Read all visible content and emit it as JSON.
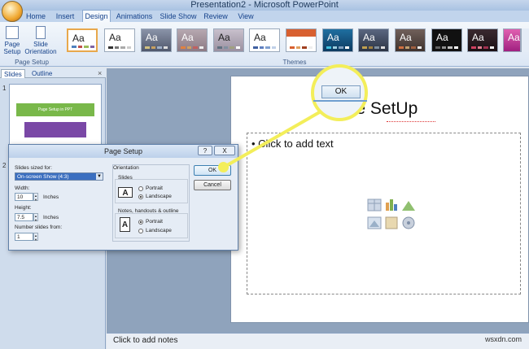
{
  "window": {
    "title": "Presentation2 - Microsoft PowerPoint"
  },
  "tabs": [
    "Home",
    "Insert",
    "Design",
    "Animations",
    "Slide Show",
    "Review",
    "View"
  ],
  "active_tab": "Design",
  "ribbon": {
    "page_setup_label": "Page\nSetup",
    "slide_orientation_label": "Slide\nOrientation",
    "group_page_setup": "Page Setup",
    "group_themes": "Themes",
    "theme_text": "Aa"
  },
  "left_pane": {
    "tabs": [
      "Slides",
      "Outline"
    ],
    "close": "×",
    "slide_numbers": [
      "1",
      "2"
    ],
    "thumb_text": "Page Setup in PPT"
  },
  "slide": {
    "title": "Page SetUp",
    "bullet": "Click to add text",
    "notes": "Click to add notes"
  },
  "dialog": {
    "title": "Page Setup",
    "help": "?",
    "close": "X",
    "slides_sized_for_label": "Slides sized for:",
    "slides_sized_for_value": "On-screen Show (4:3)",
    "width_label": "Width:",
    "width_value": "10",
    "width_unit": "Inches",
    "height_label": "Height:",
    "height_value": "7.5",
    "height_unit": "Inches",
    "number_from_label": "Number slides from:",
    "number_from_value": "1",
    "orientation_label": "Orientation",
    "slides_label": "Slides",
    "portrait": "Portrait",
    "landscape": "Landscape",
    "notes_label": "Notes, handouts & outline",
    "ok": "OK",
    "cancel": "Cancel",
    "slides_orientation_selected": "Landscape",
    "notes_orientation_selected": "Portrait"
  },
  "callout": {
    "label": "OK"
  },
  "watermark": "wsxdn.com",
  "colors": {
    "highlight": "#f3ee5a",
    "ribbon_text": "#15428b"
  }
}
